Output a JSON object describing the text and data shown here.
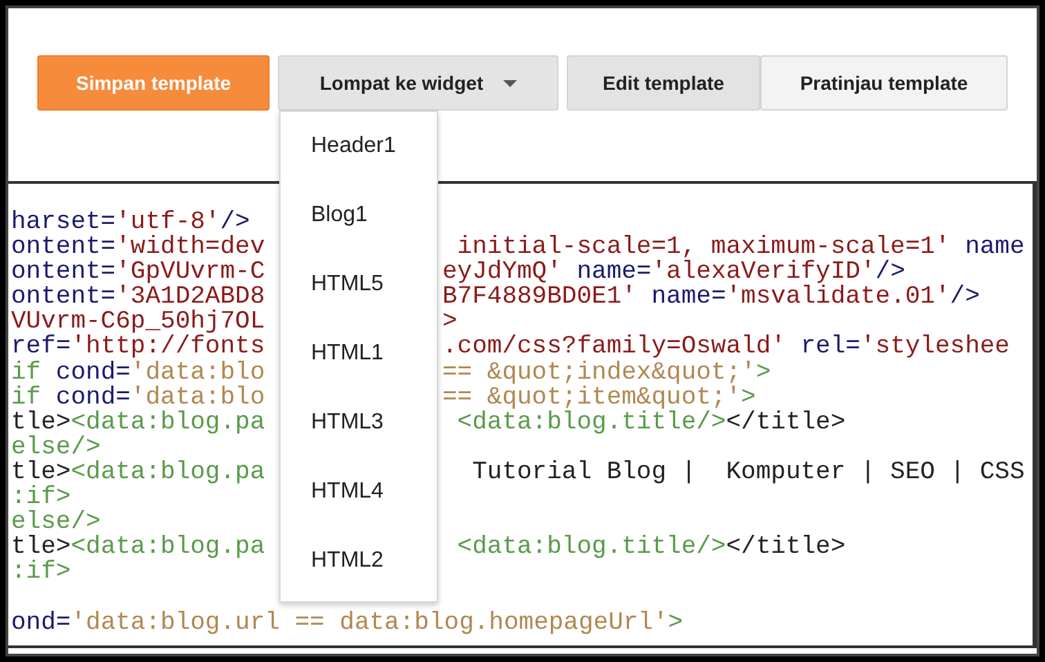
{
  "toolbar": {
    "save_button": "Simpan template",
    "jump_button": {
      "label": "Lompat ke widget",
      "expanded": true
    },
    "tabs": [
      {
        "label": "Edit template",
        "selected": true
      },
      {
        "label": "Pratinjau template",
        "selected": false
      }
    ]
  },
  "widget_menu": [
    "Header1",
    "Blog1",
    "HTML5",
    "HTML1",
    "HTML3",
    "HTML4",
    "HTML2"
  ],
  "code_lines": [
    {
      "left": [
        {
          "kind": "attr",
          "text": "harset="
        },
        {
          "kind": "value",
          "text": "'utf-8'"
        },
        {
          "kind": "attr",
          "text": "/>"
        }
      ]
    },
    {
      "left": [
        {
          "kind": "attr",
          "text": "ontent="
        },
        {
          "kind": "value",
          "text": "'width=dev"
        }
      ],
      "right": [
        {
          "kind": "value",
          "text": " initial-scale=1, maximum-scale=1'"
        },
        {
          "kind": "attr",
          "text": " name"
        }
      ]
    },
    {
      "left": [
        {
          "kind": "attr",
          "text": "ontent="
        },
        {
          "kind": "value",
          "text": "'GpVUvrm-C"
        }
      ],
      "right": [
        {
          "kind": "value",
          "text": "eyJdYmQ'"
        },
        {
          "kind": "attr",
          "text": " name="
        },
        {
          "kind": "value",
          "text": "'alexaVerifyID'"
        },
        {
          "kind": "attr",
          "text": "/>"
        }
      ]
    },
    {
      "left": [
        {
          "kind": "attr",
          "text": "ontent="
        },
        {
          "kind": "value",
          "text": "'3A1D2ABD8"
        }
      ],
      "right": [
        {
          "kind": "value",
          "text": "B7F4889BD0E1'"
        },
        {
          "kind": "attr",
          "text": " name="
        },
        {
          "kind": "value",
          "text": "'msvalidate.01'"
        },
        {
          "kind": "attr",
          "text": "/>"
        }
      ]
    },
    {
      "left": [
        {
          "kind": "comment",
          "text": "VUvrm-C6p_50hj7OL"
        }
      ],
      "right": [
        {
          "kind": "comment",
          "text": ">"
        }
      ]
    },
    {
      "left": [
        {
          "kind": "attr",
          "text": "ref="
        },
        {
          "kind": "value",
          "text": "'http://fonts"
        }
      ],
      "right": [
        {
          "kind": "value",
          "text": ".com/css?family=Oswald'"
        },
        {
          "kind": "attr",
          "text": " rel="
        },
        {
          "kind": "value",
          "text": "'styleshee"
        }
      ]
    },
    {
      "left": [
        {
          "kind": "tag",
          "text": "if"
        },
        {
          "kind": "attr",
          "text": " cond="
        },
        {
          "kind": "string",
          "text": "'data:blo"
        }
      ],
      "right": [
        {
          "kind": "string",
          "text": "== &quot;index&quot;'"
        },
        {
          "kind": "tag",
          "text": ">"
        }
      ]
    },
    {
      "left": [
        {
          "kind": "tag",
          "text": "if"
        },
        {
          "kind": "attr",
          "text": " cond="
        },
        {
          "kind": "string",
          "text": "'data:blo"
        }
      ],
      "right": [
        {
          "kind": "string",
          "text": "== &quot;item&quot;'"
        },
        {
          "kind": "tag",
          "text": ">"
        }
      ]
    },
    {
      "left": [
        {
          "kind": "plain",
          "text": "tle>"
        },
        {
          "kind": "tag",
          "text": "<data:blog.pa"
        }
      ],
      "right": [
        {
          "kind": "tag",
          "text": " <data:blog.title/>"
        },
        {
          "kind": "plain",
          "text": "</title>"
        }
      ]
    },
    {
      "left": [
        {
          "kind": "tag",
          "text": "else/>"
        }
      ]
    },
    {
      "left": [
        {
          "kind": "plain",
          "text": "tle>"
        },
        {
          "kind": "tag",
          "text": "<data:blog.pa"
        }
      ],
      "right": [
        {
          "kind": "plain",
          "text": "  Tutorial Blog |  Komputer | SEO | CSS"
        }
      ]
    },
    {
      "left": [
        {
          "kind": "tag",
          "text": ":if>"
        }
      ]
    },
    {
      "left": [
        {
          "kind": "tag",
          "text": "else/>"
        }
      ]
    },
    {
      "left": [
        {
          "kind": "plain",
          "text": "tle>"
        },
        {
          "kind": "tag",
          "text": "<data:blog.pa"
        }
      ],
      "right": [
        {
          "kind": "tag",
          "text": " <data:blog.title/>"
        },
        {
          "kind": "plain",
          "text": "</title>"
        }
      ]
    },
    {
      "left": [
        {
          "kind": "tag",
          "text": ":if>"
        }
      ]
    },
    {
      "gap_above": true,
      "left": [
        {
          "kind": "attr",
          "text": "ond="
        },
        {
          "kind": "string",
          "text": "'data:blog.url == data:blog.homepageUrl'"
        },
        {
          "kind": "tag",
          "text": ">"
        }
      ]
    }
  ]
}
